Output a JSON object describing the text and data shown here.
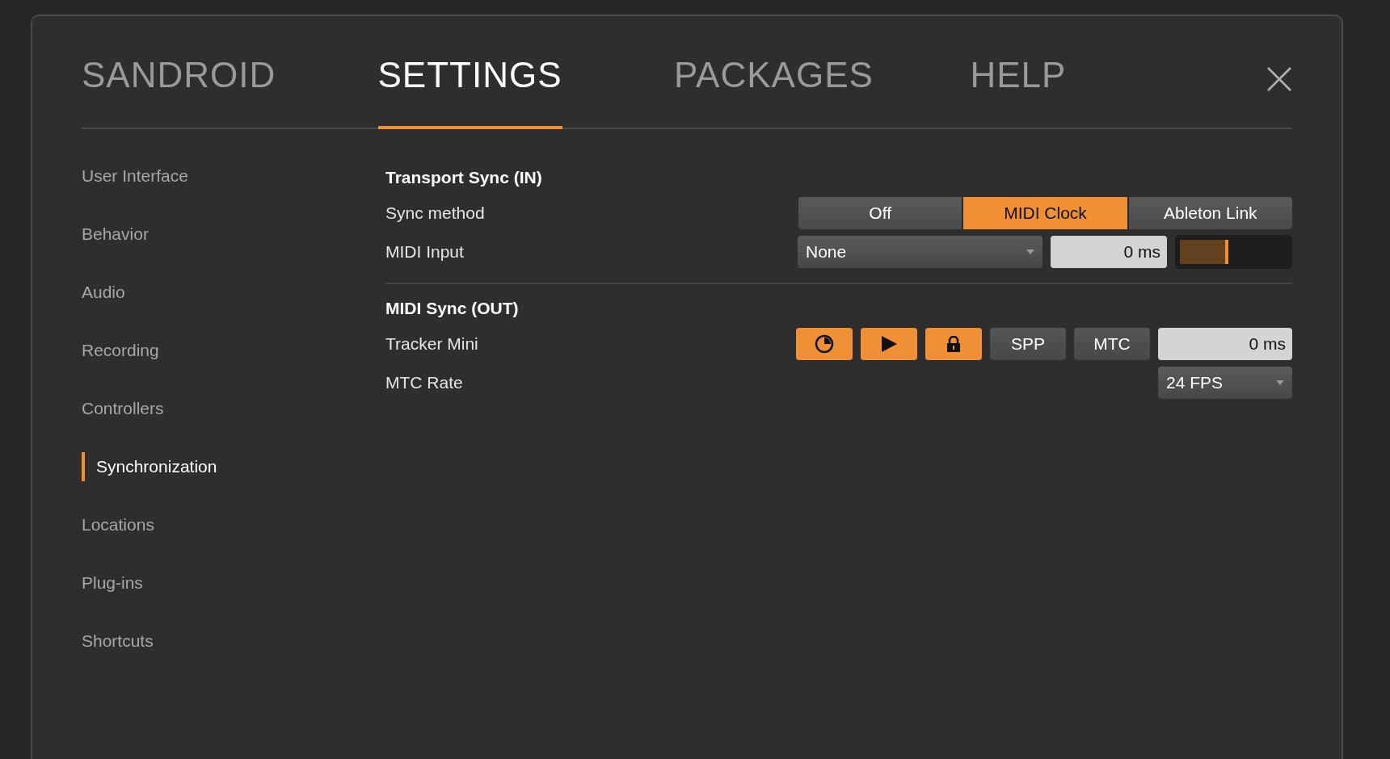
{
  "tabs": [
    {
      "label": "SANDROID",
      "selected": false
    },
    {
      "label": "SETTINGS",
      "selected": true
    },
    {
      "label": "PACKAGES",
      "selected": false
    },
    {
      "label": "HELP",
      "selected": false
    }
  ],
  "sidebar": {
    "items": [
      {
        "label": "User Interface",
        "selected": false
      },
      {
        "label": "Behavior",
        "selected": false
      },
      {
        "label": "Audio",
        "selected": false
      },
      {
        "label": "Recording",
        "selected": false
      },
      {
        "label": "Controllers",
        "selected": false
      },
      {
        "label": "Synchronization",
        "selected": true
      },
      {
        "label": "Locations",
        "selected": false
      },
      {
        "label": "Plug-ins",
        "selected": false
      },
      {
        "label": "Shortcuts",
        "selected": false
      }
    ]
  },
  "transport_sync": {
    "heading": "Transport Sync (IN)",
    "sync_method": {
      "label": "Sync method",
      "options": [
        {
          "label": "Off",
          "selected": false
        },
        {
          "label": "MIDI Clock",
          "selected": true
        },
        {
          "label": "Ableton Link",
          "selected": false
        }
      ]
    },
    "midi_input": {
      "label": "MIDI Input",
      "value": "None",
      "offset": "0 ms",
      "level": 0.45
    }
  },
  "midi_sync": {
    "heading": "MIDI Sync (OUT)",
    "device": {
      "label": "Tracker Mini",
      "toggles": [
        {
          "kind": "icon",
          "on": true
        },
        {
          "kind": "icon",
          "on": true
        },
        {
          "kind": "icon",
          "on": true
        },
        {
          "kind": "text",
          "label": "SPP",
          "on": false
        },
        {
          "kind": "text",
          "label": "MTC",
          "on": false
        }
      ],
      "offset": "0 ms"
    },
    "mtc_rate": {
      "label": "MTC Rate",
      "value": "24 FPS"
    }
  }
}
